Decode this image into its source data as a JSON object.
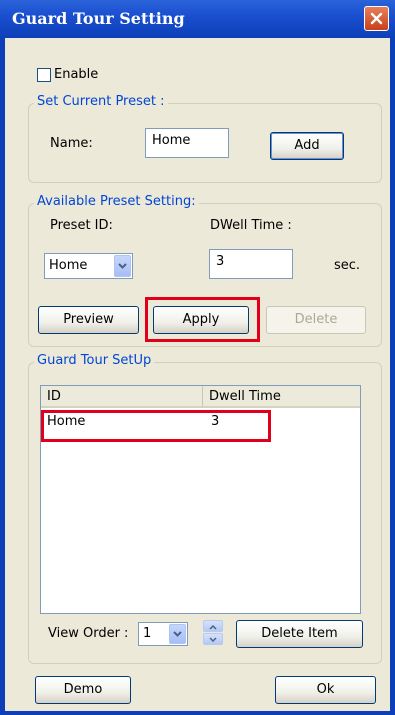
{
  "window": {
    "title": "Guard Tour Setting"
  },
  "enable": {
    "label": "Enable",
    "checked": false
  },
  "current_preset": {
    "group_title": "Set Current Preset :",
    "name_label": "Name:",
    "name_value": "Home",
    "add_label": "Add"
  },
  "available_preset": {
    "group_title": "Available Preset Setting:",
    "preset_id_label": "Preset ID:",
    "dwell_time_label": "DWell Time :",
    "preset_id_value": "Home",
    "dwell_time_value": "3",
    "sec_label": "sec.",
    "preview_label": "Preview",
    "apply_label": "Apply",
    "delete_label": "Delete"
  },
  "guard_tour": {
    "group_title": "Guard Tour SetUp",
    "columns": [
      "ID",
      "Dwell Time"
    ],
    "rows": [
      {
        "id": "Home",
        "dwell": "3"
      }
    ],
    "view_order_label": "View Order :",
    "view_order_value": "1",
    "delete_item_label": "Delete Item"
  },
  "footer": {
    "demo_label": "Demo",
    "ok_label": "Ok"
  },
  "colors": {
    "title_bar": "#0d3fb8",
    "group_title": "#0046d5",
    "highlight": "#e0001b",
    "dialog_bg": "#ece9d8"
  }
}
